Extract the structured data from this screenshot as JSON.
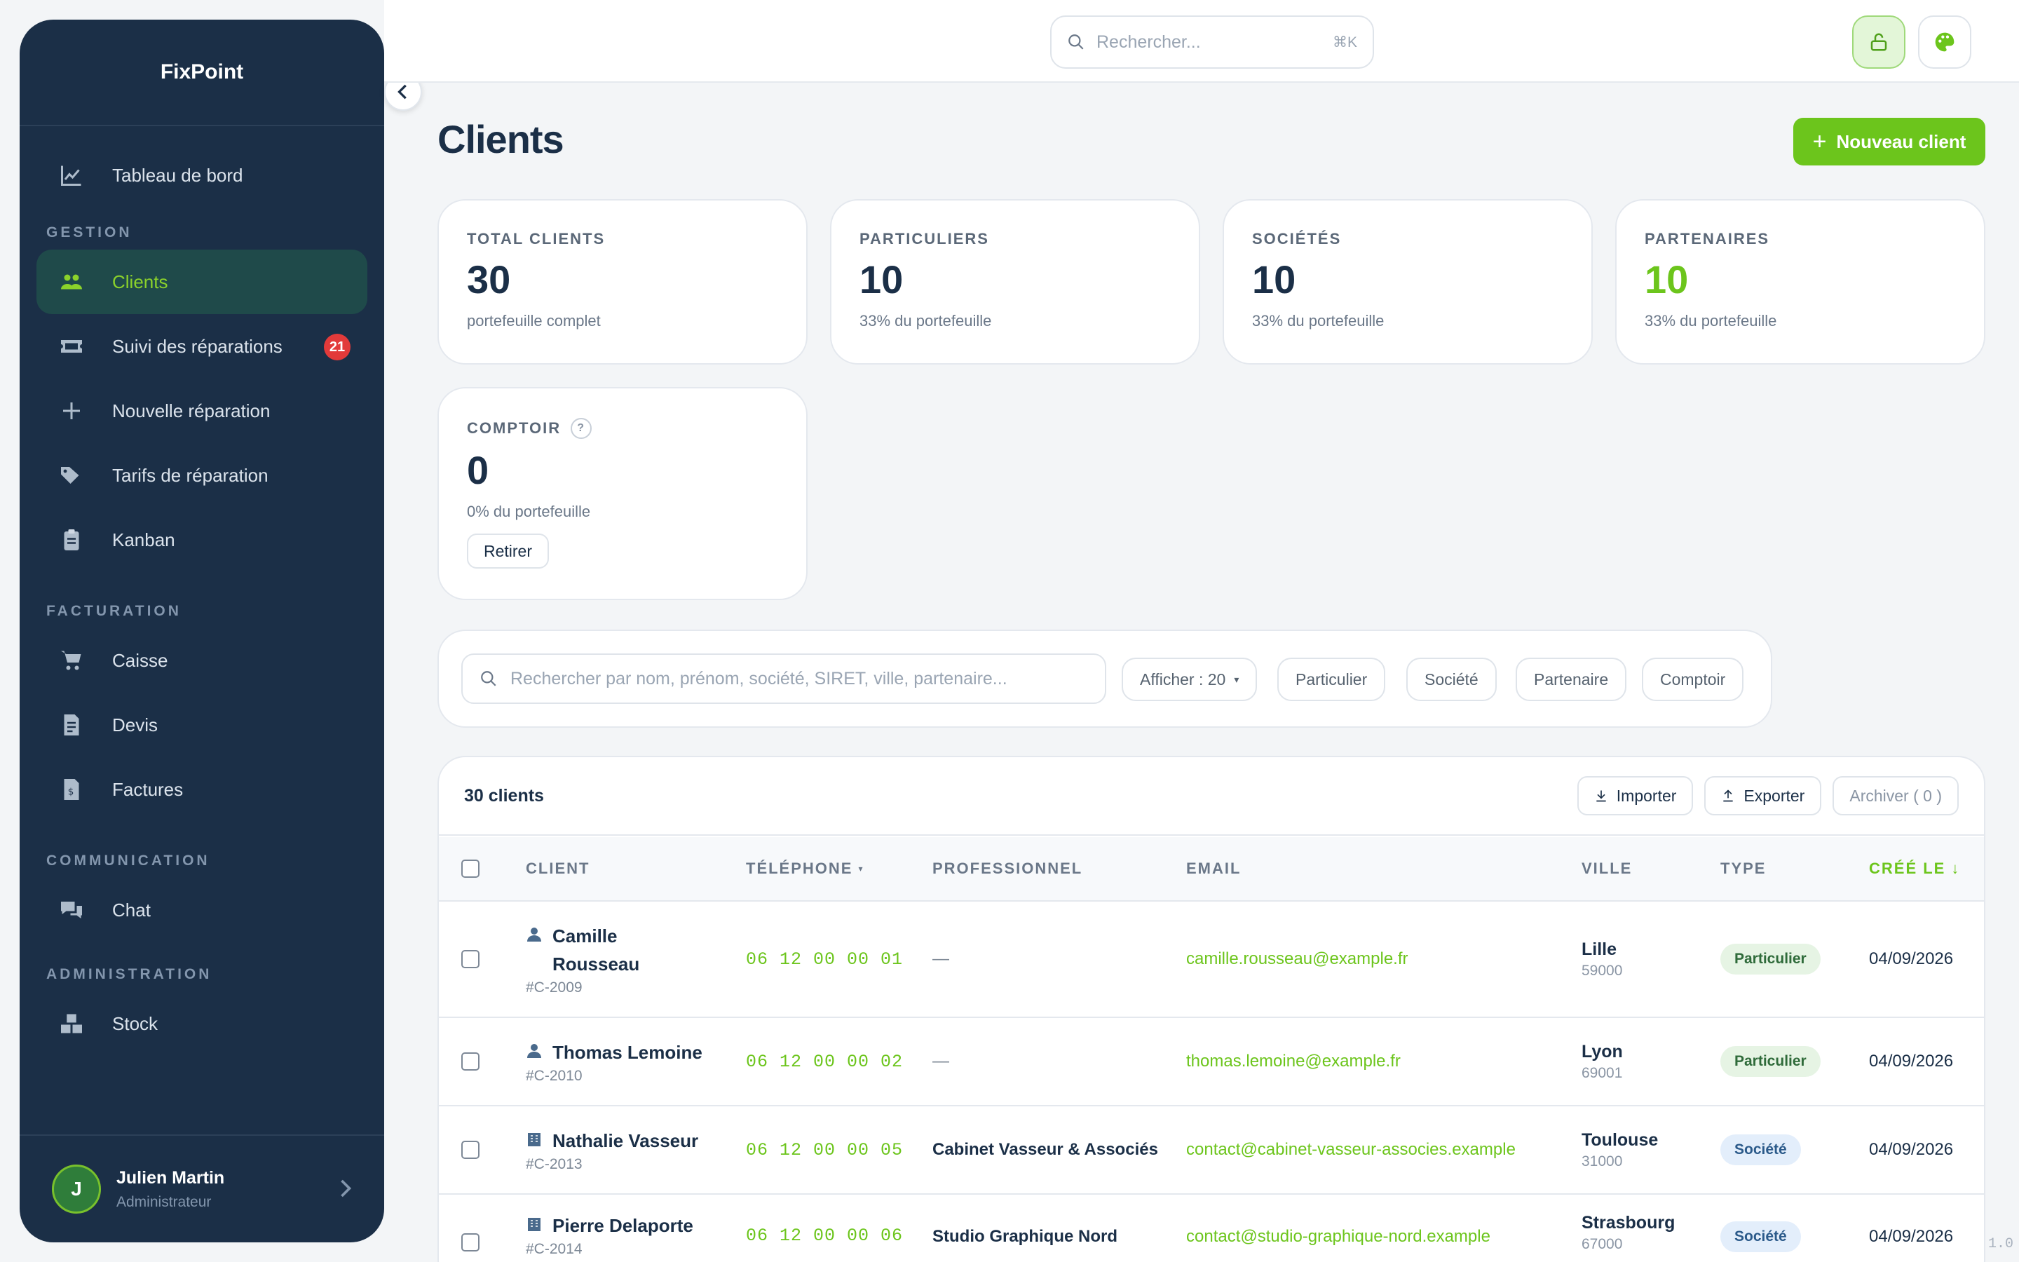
{
  "app": {
    "name": "FixPoint"
  },
  "sidebar": {
    "dashboard": "Tableau de bord",
    "sections": {
      "gestion": "GESTION",
      "facturation": "FACTURATION",
      "communication": "COMMUNICATION",
      "administration": "ADMINISTRATION"
    },
    "items": {
      "clients": "Clients",
      "suivi": "Suivi des réparations",
      "suivi_badge": "21",
      "nouvelle": "Nouvelle réparation",
      "tarifs": "Tarifs de réparation",
      "kanban": "Kanban",
      "caisse": "Caisse",
      "devis": "Devis",
      "factures": "Factures",
      "chat": "Chat",
      "stock": "Stock"
    },
    "user": {
      "initial": "J",
      "name": "Julien Martin",
      "role": "Administrateur"
    }
  },
  "topbar": {
    "search_placeholder": "Rechercher...",
    "shortcut": "⌘K"
  },
  "page": {
    "title": "Clients",
    "new_button": "Nouveau client"
  },
  "stats": [
    {
      "label": "TOTAL CLIENTS",
      "value": "30",
      "sub": "portefeuille complet"
    },
    {
      "label": "PARTICULIERS",
      "value": "10",
      "sub": "33% du portefeuille"
    },
    {
      "label": "SOCIÉTÉS",
      "value": "10",
      "sub": "33% du portefeuille"
    },
    {
      "label": "PARTENAIRES",
      "value": "10",
      "sub": "33% du portefeuille"
    },
    {
      "label": "COMPTOIR",
      "value": "0",
      "sub": "0% du portefeuille",
      "help": "?",
      "button": "Retirer"
    }
  ],
  "filters": {
    "search_placeholder": "Rechercher par nom, prénom, société, SIRET, ville, partenaire...",
    "show": "Afficher : 20",
    "chips": [
      "Particulier",
      "Société",
      "Partenaire",
      "Comptoir"
    ]
  },
  "table": {
    "count": "30 clients",
    "import": "Importer",
    "export": "Exporter",
    "archive": "Archiver ( 0 )",
    "columns": {
      "client": "CLIENT",
      "phone": "TÉLÉPHONE",
      "pro": "PROFESSIONNEL",
      "email": "EMAIL",
      "city": "VILLE",
      "type": "TYPE",
      "created": "CRÉÉ LE"
    },
    "rows": [
      {
        "name": "Camille Rousseau",
        "name_l1": "Camille",
        "name_l2": "Rousseau",
        "id": "#C-2009",
        "phone": "06 12 00 00 01",
        "pro": "—",
        "email": "camille.rousseau@example.fr",
        "city": "Lille",
        "zip": "59000",
        "type": "Particulier",
        "date": "04/09/2026"
      },
      {
        "name": "Thomas Lemoine",
        "id": "#C-2010",
        "phone": "06 12 00 00 02",
        "pro": "—",
        "email": "thomas.lemoine@example.fr",
        "city": "Lyon",
        "zip": "69001",
        "type": "Particulier",
        "date": "04/09/2026"
      },
      {
        "name": "Nathalie Vasseur",
        "id": "#C-2013",
        "phone": "06 12 00 00 05",
        "pro": "Cabinet Vasseur & Associés",
        "email": "contact@cabinet-vasseur-associes.example",
        "city": "Toulouse",
        "zip": "31000",
        "type": "Société",
        "date": "04/09/2026"
      },
      {
        "name": "Pierre Delaporte",
        "id": "#C-2014",
        "phone": "06 12 00 00 06",
        "pro": "Studio Graphique Nord",
        "email": "contact@studio-graphique-nord.example",
        "city": "Strasbourg",
        "zip": "67000",
        "type": "Société",
        "date": "04/09/2026"
      }
    ]
  },
  "version": "1.0",
  "colors": {
    "sidebar": "#1b2f47",
    "accent": "#6cc51c",
    "badge": "#e23a3a"
  }
}
